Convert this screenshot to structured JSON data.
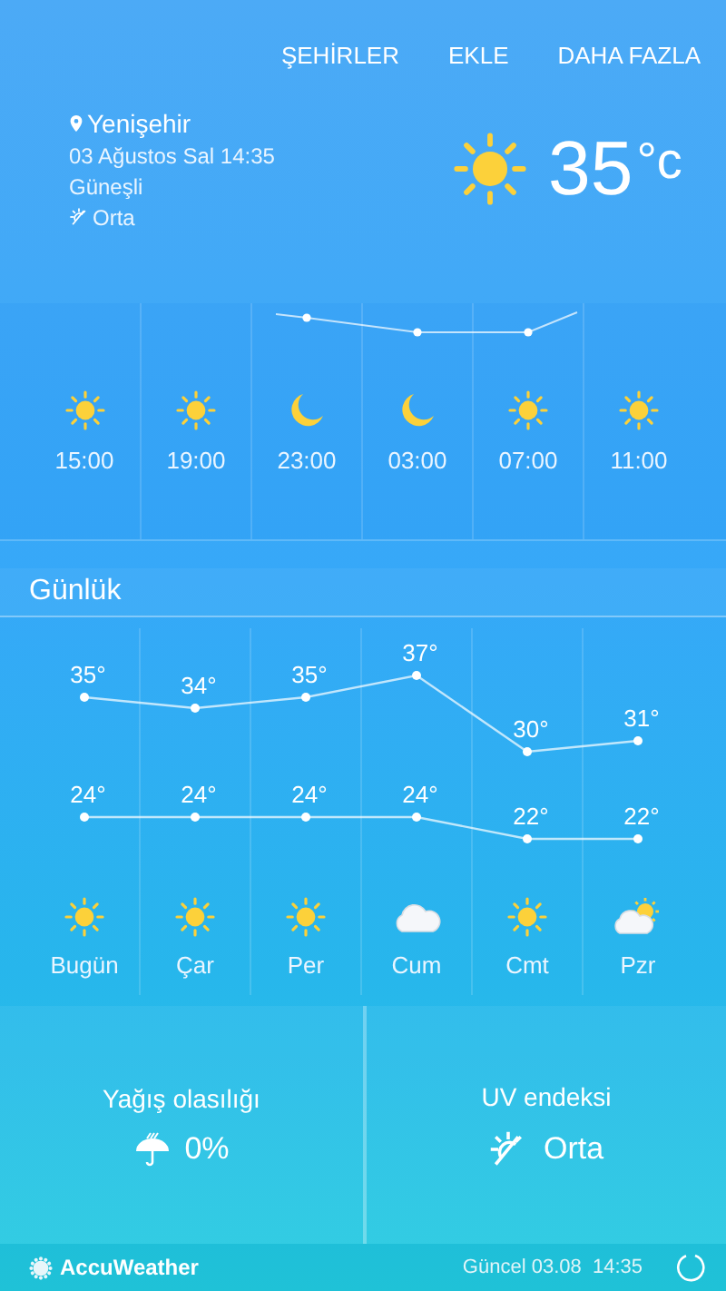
{
  "nav": [
    {
      "label": "ŞEHİRLER"
    },
    {
      "label": "EKLE"
    },
    {
      "label": "DAHA FAZLA"
    }
  ],
  "current": {
    "location": "Yenişehir",
    "datetime": "03 Ağustos Sal 14:35",
    "condition": "Güneşli",
    "uv": "Orta",
    "temperature": "35",
    "unit": "°c"
  },
  "hourly": [
    {
      "time": "15:00",
      "kind": "sunny"
    },
    {
      "time": "19:00",
      "kind": "sunny"
    },
    {
      "time": "23:00",
      "kind": "night"
    },
    {
      "time": "03:00",
      "kind": "night"
    },
    {
      "time": "07:00",
      "kind": "sunny"
    },
    {
      "time": "11:00",
      "kind": "sunny"
    }
  ],
  "daily": {
    "title": "Günlük",
    "chart_data": {
      "type": "line",
      "categories": [
        "Bugün",
        "Çar",
        "Per",
        "Cum",
        "Cmt",
        "Pzr"
      ],
      "data_labels": true,
      "series": [
        {
          "color": "#ffffff",
          "marker": true,
          "values": [
            35,
            34,
            35,
            37,
            30,
            31
          ],
          "value_labels": [
            "35°",
            "34°",
            "35°",
            "37°",
            "30°",
            "31°"
          ]
        },
        {
          "color": "#ffffff",
          "marker": true,
          "values": [
            24,
            24,
            24,
            24,
            22,
            22
          ],
          "value_labels": [
            "24°",
            "24°",
            "24°",
            "24°",
            "22°",
            "22°"
          ]
        }
      ]
    },
    "days": [
      {
        "kind": "sunny"
      },
      {
        "kind": "sunny"
      },
      {
        "kind": "sunny"
      },
      {
        "kind": "cloudy"
      },
      {
        "kind": "sunny"
      },
      {
        "kind": "partly_cloudy"
      }
    ]
  },
  "details": [
    {
      "title": "Yağış olasılığı",
      "value": "0%",
      "kind": "rain"
    },
    {
      "title": "UV endeksi",
      "value": "Orta",
      "kind": "uv"
    }
  ],
  "footer": {
    "brand": "AccuWeather",
    "updated": "Güncel 03.08  14:35"
  }
}
